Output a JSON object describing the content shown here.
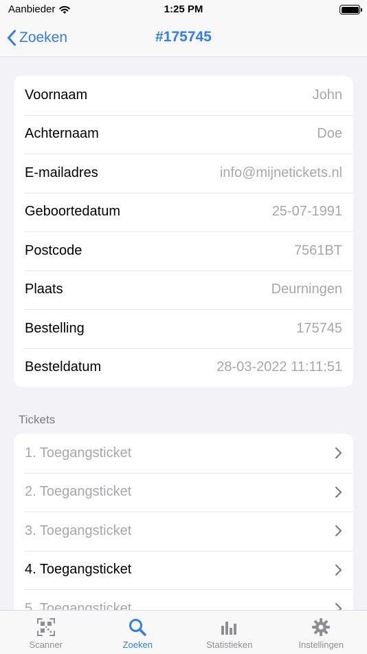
{
  "status_bar": {
    "carrier": "Aanbieder",
    "time": "1:25 PM"
  },
  "nav": {
    "back_label": "Zoeken",
    "title": "#175745"
  },
  "info": [
    {
      "label": "Voornaam",
      "value": "John"
    },
    {
      "label": "Achternaam",
      "value": "Doe"
    },
    {
      "label": "E-mailadres",
      "value": "info@mijnetickets.nl"
    },
    {
      "label": "Geboortedatum",
      "value": "25-07-1991"
    },
    {
      "label": "Postcode",
      "value": "7561BT"
    },
    {
      "label": "Plaats",
      "value": "Deurningen"
    },
    {
      "label": "Bestelling",
      "value": "175745"
    },
    {
      "label": "Besteldatum",
      "value": "28-03-2022 11:11:51"
    }
  ],
  "tickets_header": "Tickets",
  "tickets": [
    {
      "label": "1. Toegangsticket",
      "scanned": true
    },
    {
      "label": "2. Toegangsticket",
      "scanned": true
    },
    {
      "label": "3. Toegangsticket",
      "scanned": true
    },
    {
      "label": "4. Toegangsticket",
      "scanned": false
    },
    {
      "label": "5. Toegangsticket",
      "scanned": true
    }
  ],
  "tabs": [
    {
      "label": "Scanner",
      "icon": "qr-code-icon",
      "active": false
    },
    {
      "label": "Zoeken",
      "icon": "search-icon",
      "active": true
    },
    {
      "label": "Statistieken",
      "icon": "bar-chart-icon",
      "active": false
    },
    {
      "label": "Instellingen",
      "icon": "gear-icon",
      "active": false
    }
  ],
  "colors": {
    "accent": "#2f7cf6",
    "background": "#f2f2f7",
    "secondary_text": "#a7a7ac",
    "inactive_tab": "#8e8e93"
  }
}
